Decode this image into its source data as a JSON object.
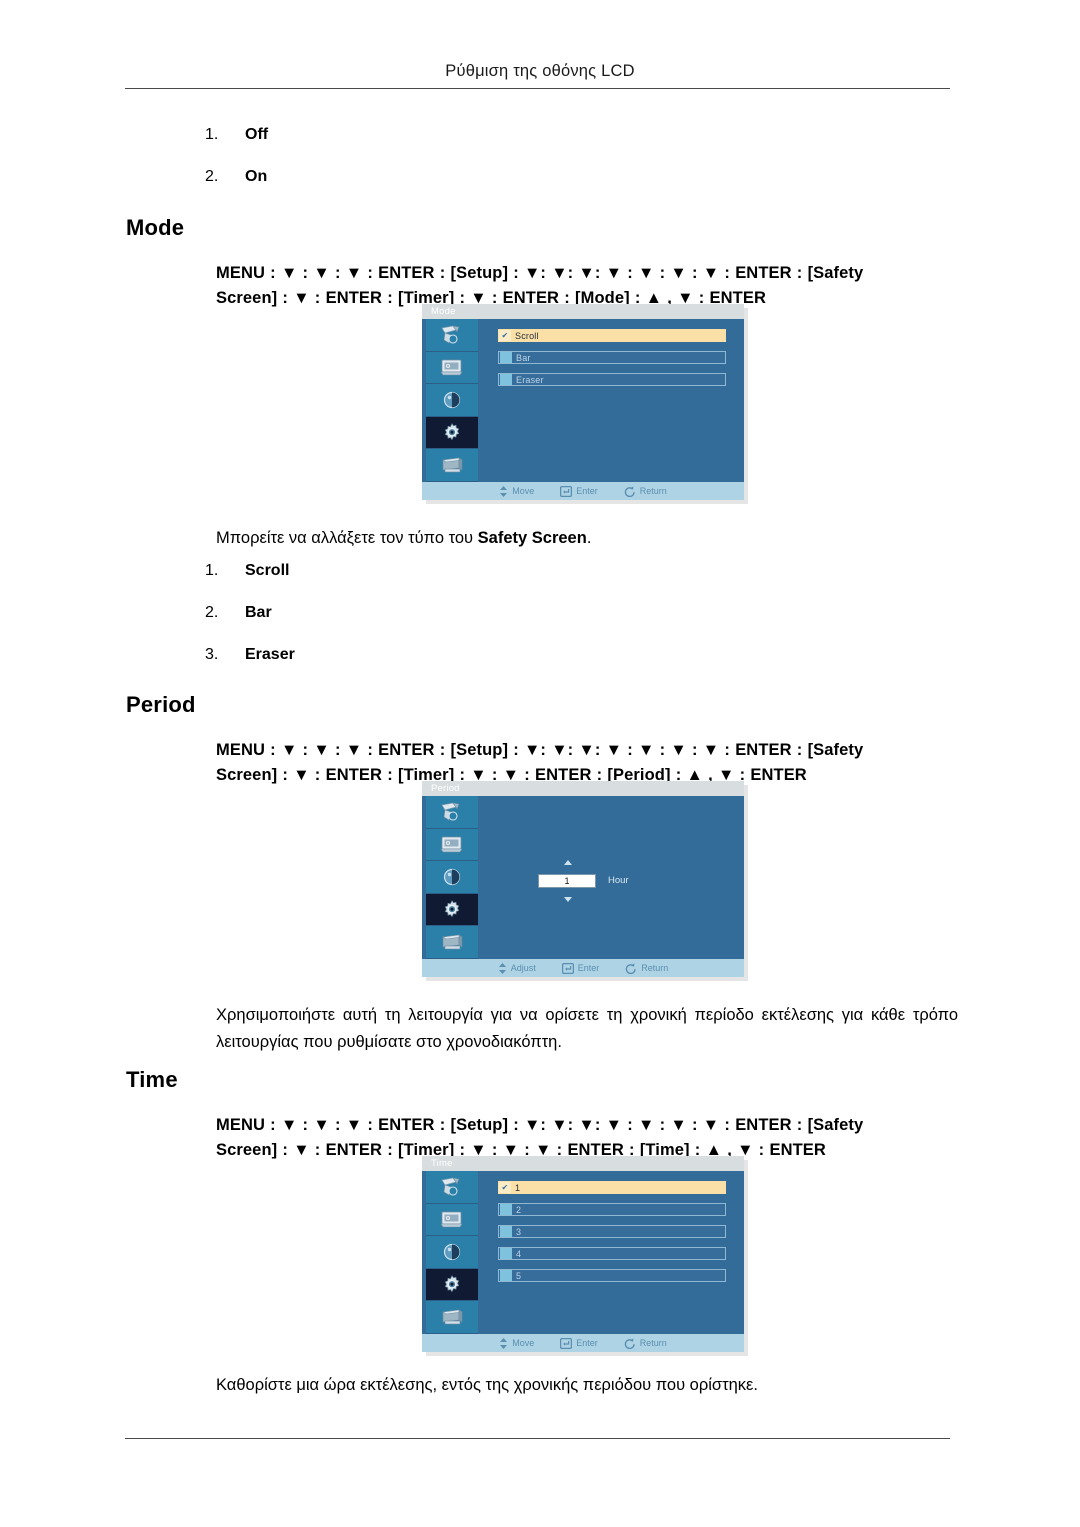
{
  "header": {
    "running_title": "Ρύθμιση της οθόνης LCD"
  },
  "top_list": {
    "items": [
      {
        "index": "1.",
        "label": "Off"
      },
      {
        "index": "2.",
        "label": "On"
      }
    ]
  },
  "sections": [
    {
      "heading": "Mode",
      "menu_path_line1": "MENU : ▼ : ▼ : ▼ :  ENTER :  [Setup] :  ▼:  ▼:  ▼:  ▼ :  ▼ :  ▼ :  ▼ :  ENTER :  [Safety",
      "menu_path_line2": "Screen]  :  ▼ : ENTER : [Timer] :     ▼ : ENTER : [Mode] :    ▲ , ▼ : ENTER",
      "osd": {
        "title": "Mode",
        "rows": [
          {
            "label": "Scroll",
            "selected": true
          },
          {
            "label": "Bar",
            "selected": false
          },
          {
            "label": "Eraser",
            "selected": false
          }
        ],
        "footer": [
          {
            "icon": "updown-arrow-icon",
            "label": "Move"
          },
          {
            "icon": "enter-key-icon",
            "label": "Enter"
          },
          {
            "icon": "return-arrow-icon",
            "label": "Return"
          }
        ]
      },
      "description_prefix": "Μπορείτε να αλλάξετε τον τύπο του ",
      "description_bold": "Safety Screen",
      "description_suffix": ".",
      "list": [
        {
          "index": "1.",
          "label": "Scroll"
        },
        {
          "index": "2.",
          "label": "Bar"
        },
        {
          "index": "3.",
          "label": "Eraser"
        }
      ]
    },
    {
      "heading": "Period",
      "menu_path_line1": "MENU : ▼ : ▼ : ▼ :  ENTER :  [Setup] :  ▼:  ▼:  ▼:  ▼ :  ▼ :  ▼ :  ▼ :  ENTER :  [Safety",
      "menu_path_line2": "Screen]  :  ▼ : ENTER : [Timer] :     ▼ :  ▼ : ENTER : [Period] :    ▲ , ▼ : ENTER",
      "osd": {
        "title": "Period",
        "spinner_value": "1",
        "spinner_unit": "Hour",
        "footer": [
          {
            "icon": "updown-arrow-icon",
            "label": "Adjust"
          },
          {
            "icon": "enter-key-icon",
            "label": "Enter"
          },
          {
            "icon": "return-arrow-icon",
            "label": "Return"
          }
        ]
      },
      "paragraph": "Χρησιμοποιήστε αυτή τη λειτουργία για να ορίσετε τη χρονική περίοδο εκτέλεσης για κάθε τρόπο λειτουργίας που ρυθμίσατε στο χρονοδιακόπτη."
    },
    {
      "heading": "Time",
      "menu_path_line1": "MENU : ▼ : ▼ : ▼ :  ENTER :  [Setup] :  ▼:  ▼:  ▼:  ▼ :  ▼ :  ▼ :  ▼ :  ENTER :  [Safety",
      "menu_path_line2": "Screen]  :  ▼ : ENTER : [Timer] :     ▼ :  ▼ :  ▼ : ENTER : [Time] :    ▲ , ▼ : ENTER",
      "osd": {
        "title": "Time",
        "rows": [
          {
            "label": "1",
            "selected": true
          },
          {
            "label": "2",
            "selected": false
          },
          {
            "label": "3",
            "selected": false
          },
          {
            "label": "4",
            "selected": false
          },
          {
            "label": "5",
            "selected": false
          }
        ],
        "footer": [
          {
            "icon": "updown-arrow-icon",
            "label": "Move"
          },
          {
            "icon": "enter-key-icon",
            "label": "Enter"
          },
          {
            "icon": "return-arrow-icon",
            "label": "Return"
          }
        ]
      },
      "paragraph": "Καθορίστε μια ώρα εκτέλεσης, εντός της χρονικής περιόδου που ορίστηκε."
    }
  ],
  "osd_sidebar_icons": [
    "brush-tool-icon",
    "display-monitor-icon",
    "contrast-circle-icon",
    "gear-setup-icon",
    "multi-screen-icon"
  ],
  "colors": {
    "osd_background": "#336b99",
    "osd_titlebar": "#d8dde0",
    "osd_sidebar": "#2a80a8",
    "osd_sidebar_selected": "#101a33",
    "osd_row_highlight": "#fadfa6",
    "osd_footer": "#aed3e5",
    "page_rule": "#4a4a4a"
  }
}
